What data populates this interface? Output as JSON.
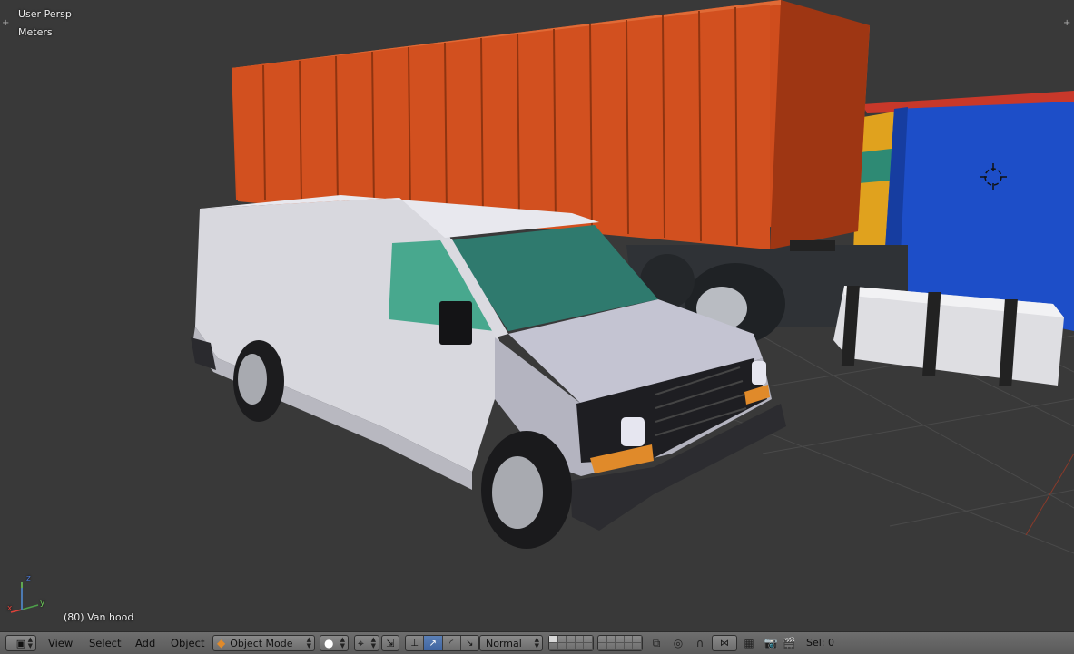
{
  "viewport": {
    "view_name": "User Persp",
    "units": "Meters",
    "active_object": "(80) Van hood",
    "axis_labels": {
      "x": "x",
      "y": "y",
      "z": "z"
    }
  },
  "header": {
    "menus": {
      "view": "View",
      "select": "Select",
      "add": "Add",
      "object": "Object"
    },
    "mode": "Object Mode",
    "orientation": "Normal",
    "selection": "Sel: 0"
  },
  "icons": {
    "editor_type": "cube-view-icon",
    "mode": "orange-cube-icon",
    "shading": "sphere-shading-icon",
    "pivot": "pivot-point-icon",
    "manipulator": "manipulator-arrows-icon",
    "render": "camera-icon",
    "anim": "clapperboard-icon"
  },
  "colors": {
    "viewport_bg": "#393939",
    "header_bg": "#666666",
    "container_orange": "#d5501e",
    "truck_blue": "#1a4fc4",
    "van_white": "#d6d6dc",
    "window_teal": "#3d9080"
  }
}
